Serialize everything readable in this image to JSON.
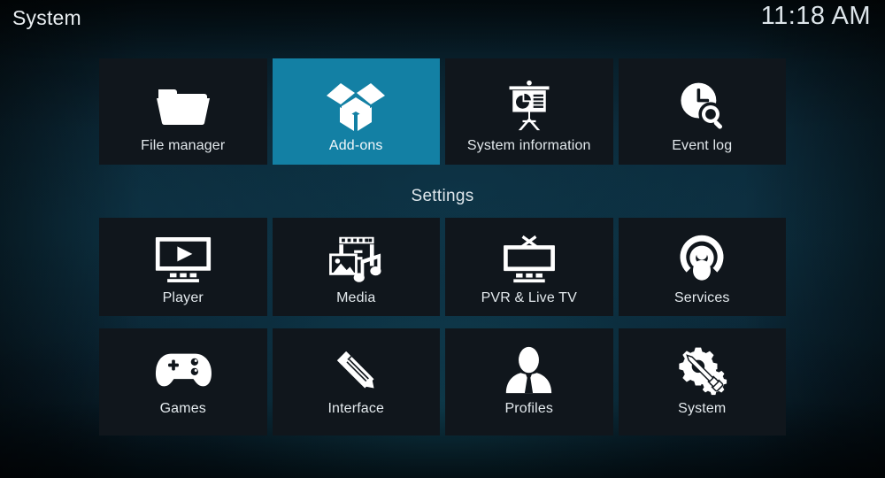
{
  "header": {
    "title": "System",
    "clock": "11:18 AM"
  },
  "settings_heading": "Settings",
  "colors": {
    "selected_tile": "#1380a4",
    "tile_background": "#10161c",
    "label_text": "#e3e9ed",
    "background_top": "#05131a",
    "background_mid": "#0d2a38"
  },
  "rows": {
    "top": [
      {
        "label": "File manager",
        "icon": "folder-icon",
        "selected": false
      },
      {
        "label": "Add-ons",
        "icon": "open-box-icon",
        "selected": true
      },
      {
        "label": "System information",
        "icon": "presentation-icon",
        "selected": false
      },
      {
        "label": "Event log",
        "icon": "clock-search-icon",
        "selected": false
      }
    ],
    "middle": [
      {
        "label": "Player",
        "icon": "monitor-play-icon",
        "selected": false
      },
      {
        "label": "Media",
        "icon": "film-photo-music-icon",
        "selected": false
      },
      {
        "label": "PVR & Live TV",
        "icon": "tv-antenna-icon",
        "selected": false
      },
      {
        "label": "Services",
        "icon": "broadcast-person-icon",
        "selected": false
      }
    ],
    "bottom": [
      {
        "label": "Games",
        "icon": "gamepad-icon",
        "selected": false
      },
      {
        "label": "Interface",
        "icon": "pencil-ruler-icon",
        "selected": false
      },
      {
        "label": "Profiles",
        "icon": "person-bust-icon",
        "selected": false
      },
      {
        "label": "System",
        "icon": "gear-screwdriver-icon",
        "selected": false
      }
    ]
  }
}
